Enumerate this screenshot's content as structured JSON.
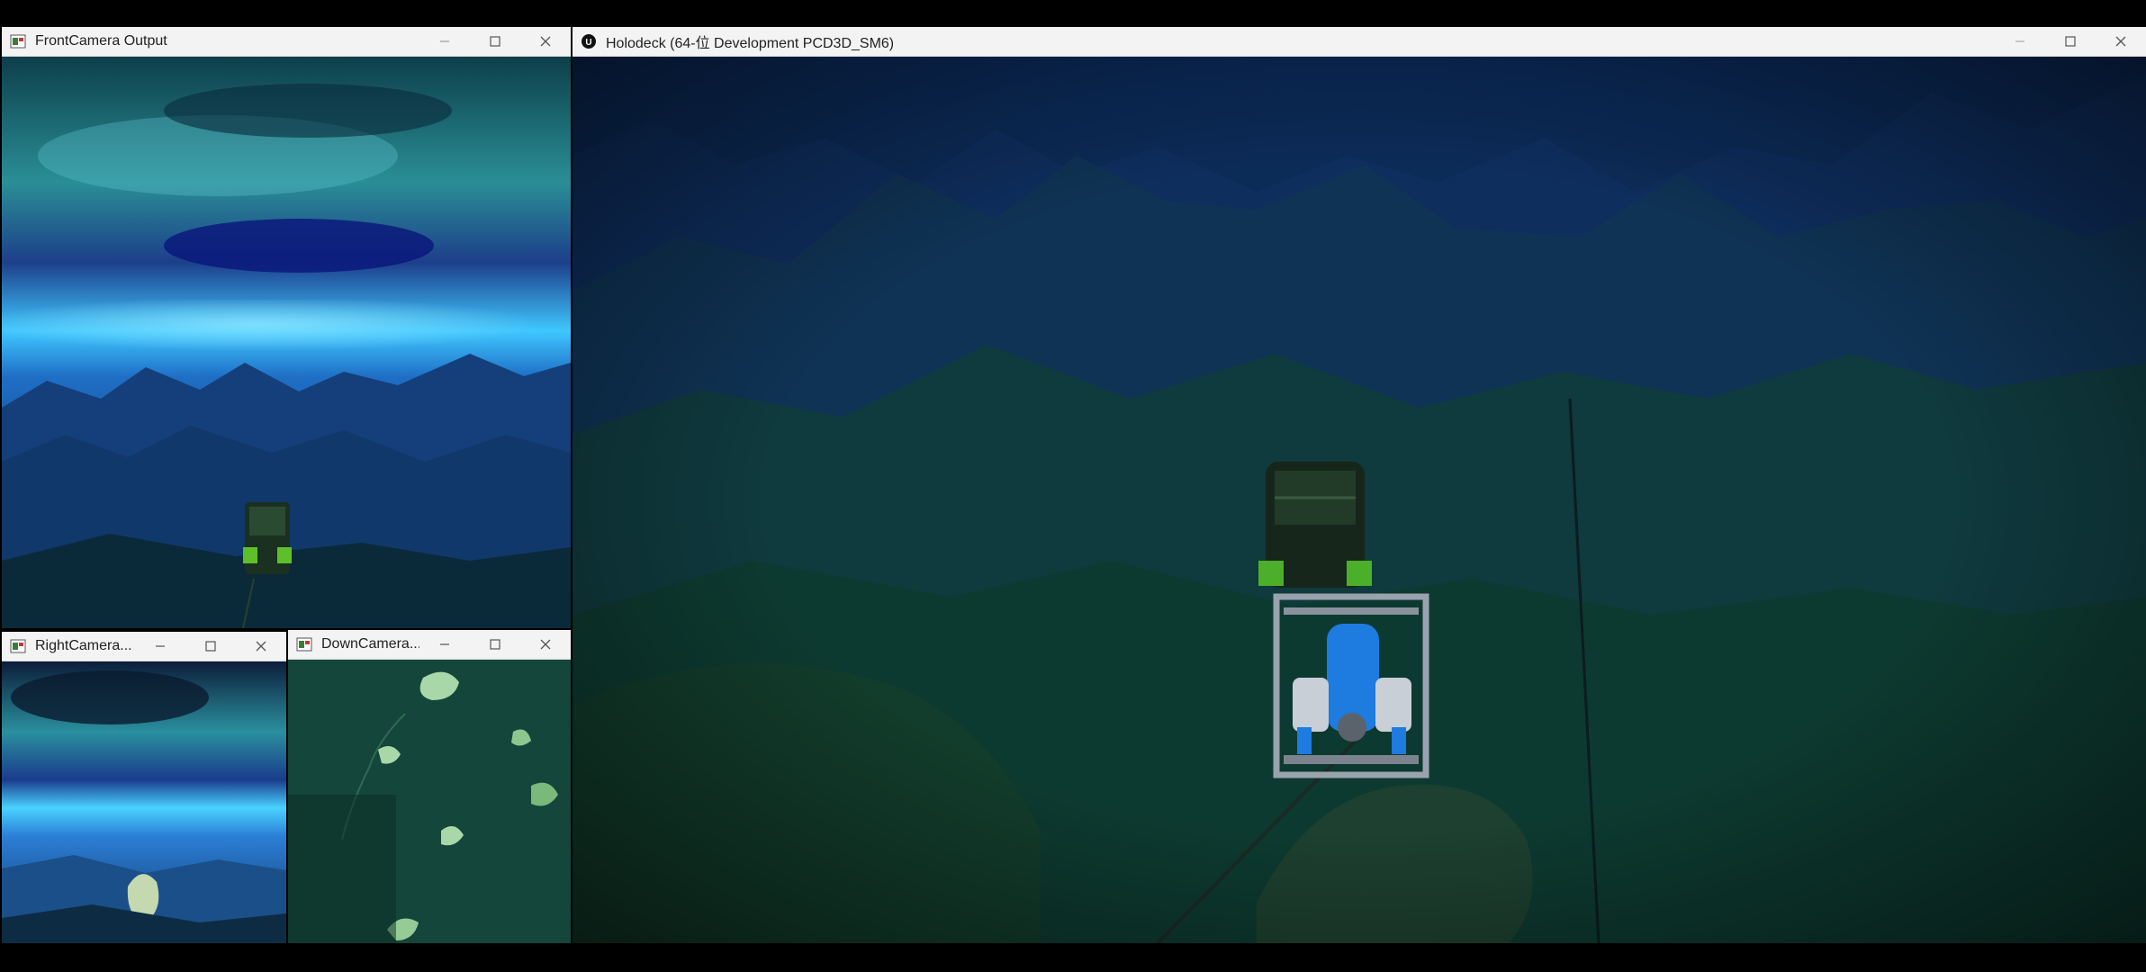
{
  "windows": {
    "front": {
      "title": "FrontCamera Output",
      "icon": "opencv-window-icon"
    },
    "right": {
      "title": "RightCamera...",
      "icon": "opencv-window-icon"
    },
    "down": {
      "title": "DownCamera...",
      "icon": "opencv-window-icon"
    },
    "main": {
      "title": "Holodeck   (64-位 Development PCD3D_SM6)",
      "icon": "unreal-engine-icon"
    }
  },
  "controls": {
    "minimize": "minimize-icon",
    "maximize": "maximize-icon",
    "close": "close-icon"
  },
  "colors": {
    "titlebar": "#f3f3f3",
    "water_deep": "#0b2a5a",
    "water_surface": "#3ec6ff",
    "seafloor": "#0f3d2f",
    "rov_frame": "#9aa3ad",
    "rov_thruster": "#1e7be0",
    "rov_green": "#4caf2a"
  }
}
